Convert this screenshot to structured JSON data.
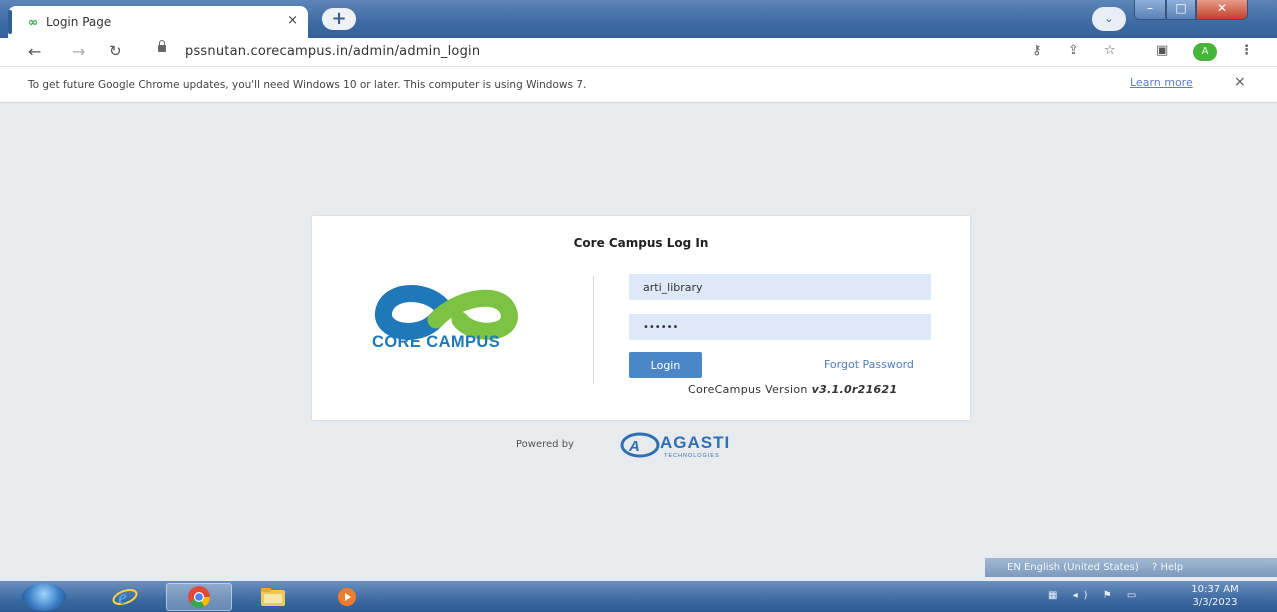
{
  "browser": {
    "tab_title": "Login Page",
    "tab_close": "×",
    "new_tab": "+",
    "url": "pssnutan.corecampus.in/admin/admin_login",
    "profile_initial": "A"
  },
  "info_bar": {
    "message": "To get future Google Chrome updates, you'll need Windows 10 or later. This computer is using Windows 7.",
    "link": "Learn more",
    "close": "×"
  },
  "login": {
    "title": "Core Campus Log In",
    "logo_text": "CORE CAMPUS",
    "username_value": "arti_library",
    "password_value": "••••••",
    "login_button": "Login",
    "forgot_password": "Forgot Password",
    "version_label": "CoreCampus Version",
    "version_number": "v3.1.0r21621"
  },
  "footer": {
    "powered_by": "Powered by",
    "brand": "AGASTI",
    "brand_tagline": "TECHNOLOGIES"
  },
  "taskbar": {
    "language": "EN English (United States)",
    "help": "Help",
    "time": "10:37 AM",
    "date": "3/3/2023"
  },
  "colors": {
    "accent_blue": "#4a86c8",
    "logo_blue": "#1f78b8",
    "logo_green": "#7cc243",
    "field_bg": "#dde9f8"
  }
}
